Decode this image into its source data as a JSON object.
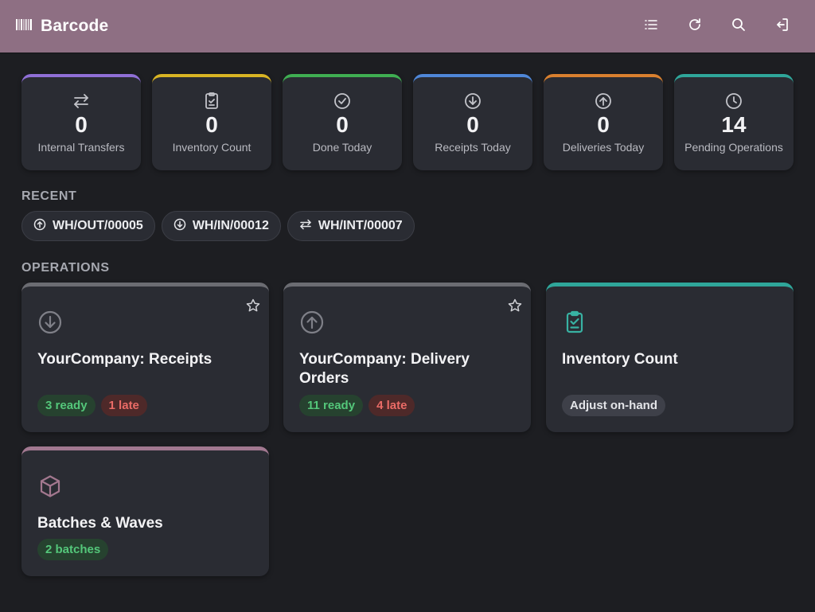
{
  "app": {
    "title": "Barcode"
  },
  "header_icons": [
    "barcode-icon",
    "list-icon",
    "refresh-icon",
    "search-icon",
    "logout-icon"
  ],
  "colors": {
    "header": "#8e6f83",
    "internal": "#8f6fd6",
    "inventory": "#d8b424",
    "done": "#3fae52",
    "receipts": "#4f87d8",
    "deliveries": "#d9802f",
    "pending": "#2fa69a",
    "ready": "#54c77a",
    "late": "#ea6b66"
  },
  "stats": [
    {
      "value": "0",
      "label": "Internal Transfers",
      "icon": "transfer-icon"
    },
    {
      "value": "0",
      "label": "Inventory Count",
      "icon": "clipboard-check-icon"
    },
    {
      "value": "0",
      "label": "Done Today",
      "icon": "check-circle-icon"
    },
    {
      "value": "0",
      "label": "Receipts Today",
      "icon": "arrow-down-circle-icon"
    },
    {
      "value": "0",
      "label": "Deliveries Today",
      "icon": "arrow-up-circle-icon"
    },
    {
      "value": "14",
      "label": "Pending Operations",
      "icon": "clock-icon"
    }
  ],
  "recent": {
    "title": "RECENT",
    "items": [
      {
        "label": "WH/OUT/00005",
        "icon": "arrow-up-circle-icon"
      },
      {
        "label": "WH/IN/00012",
        "icon": "arrow-down-circle-icon"
      },
      {
        "label": "WH/INT/00007",
        "icon": "transfer-icon"
      }
    ]
  },
  "operations": {
    "title": "OPERATIONS",
    "cards": [
      {
        "title": "YourCompany: Receipts",
        "icon": "arrow-down-circle-icon",
        "starred": false,
        "badges": [
          {
            "label": "3 ready",
            "kind": "ready"
          },
          {
            "label": "1 late",
            "kind": "late"
          }
        ]
      },
      {
        "title": "YourCompany: Delivery Orders",
        "icon": "arrow-up-circle-icon",
        "starred": false,
        "badges": [
          {
            "label": "11 ready",
            "kind": "ready"
          },
          {
            "label": "4 late",
            "kind": "late"
          }
        ]
      },
      {
        "title": "Inventory Count",
        "icon": "clipboard-check-icon",
        "badges": [
          {
            "label": "Adjust on-hand",
            "kind": "neutral"
          }
        ]
      },
      {
        "title": "Batches & Waves",
        "icon": "box-icon",
        "badges": [
          {
            "label": "2 batches",
            "kind": "ready"
          }
        ]
      }
    ]
  }
}
